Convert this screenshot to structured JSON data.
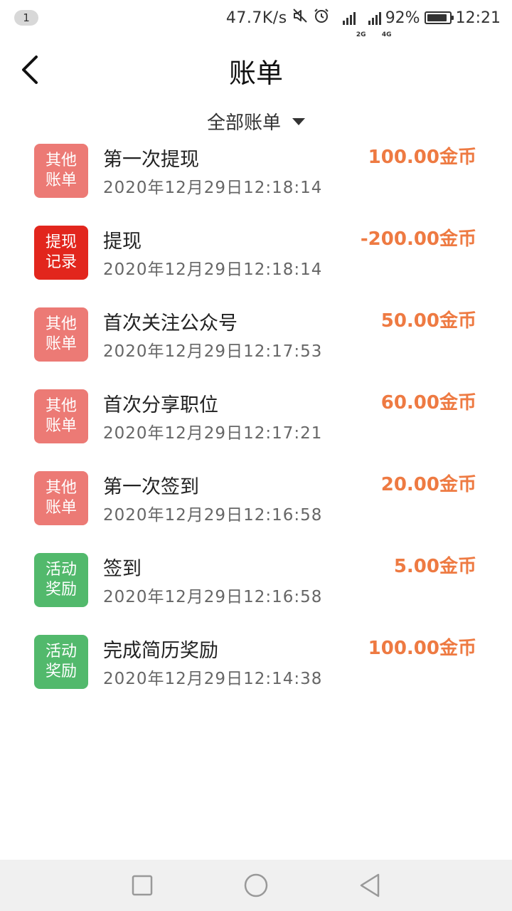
{
  "status_bar": {
    "notification_count": "1",
    "net_speed": "47.7K/s",
    "sim1_type": "2G",
    "sim2_type": "4G",
    "battery": "92%",
    "battery_level": 0.92,
    "time": "12:21"
  },
  "header": {
    "title": "账单"
  },
  "filter": {
    "label": "全部账单"
  },
  "bills": [
    {
      "tag": "其他账单",
      "tag_type": "other",
      "title": "第一次提现",
      "time": "2020年12月29日12:18:14",
      "amount": "100.00金币"
    },
    {
      "tag": "提现记录",
      "tag_type": "withdraw",
      "title": "提现",
      "time": "2020年12月29日12:18:14",
      "amount": "-200.00金币"
    },
    {
      "tag": "其他账单",
      "tag_type": "other",
      "title": "首次关注公众号",
      "time": "2020年12月29日12:17:53",
      "amount": "50.00金币"
    },
    {
      "tag": "其他账单",
      "tag_type": "other",
      "title": "首次分享职位",
      "time": "2020年12月29日12:17:21",
      "amount": "60.00金币"
    },
    {
      "tag": "其他账单",
      "tag_type": "other",
      "title": "第一次签到",
      "time": "2020年12月29日12:16:58",
      "amount": "20.00金币"
    },
    {
      "tag": "活动奖励",
      "tag_type": "activity",
      "title": "签到",
      "time": "2020年12月29日12:16:58",
      "amount": "5.00金币"
    },
    {
      "tag": "活动奖励",
      "tag_type": "activity",
      "title": "完成简历奖励",
      "time": "2020年12月29日12:14:38",
      "amount": "100.00金币"
    }
  ],
  "colors": {
    "tag_other": "#ec7a75",
    "tag_withdraw": "#e2261d",
    "tag_activity": "#52b96c",
    "amount": "#ee7a42"
  },
  "icons": {
    "back": "chevron-left-icon",
    "filter": "triangle-down-icon",
    "nav_recent": "square-icon",
    "nav_home": "circle-icon",
    "nav_back": "triangle-left-icon"
  }
}
